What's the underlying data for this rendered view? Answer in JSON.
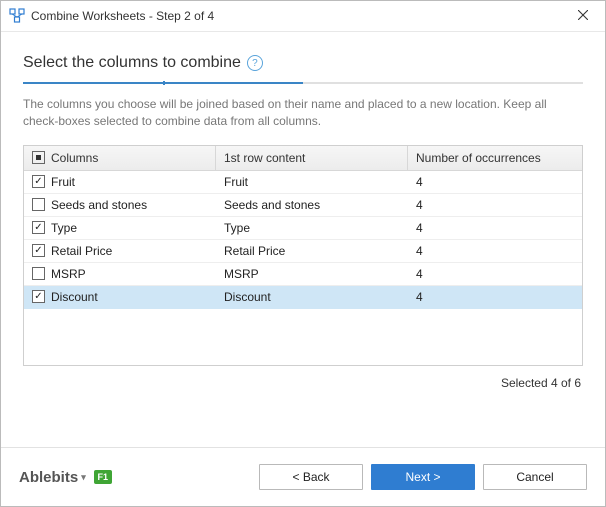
{
  "window": {
    "title": "Combine Worksheets - Step 2 of 4"
  },
  "header": {
    "heading": "Select the columns to combine",
    "help_tooltip": "?"
  },
  "description": "The columns you choose will be joined based on their name and placed to a new location. Keep all check-boxes selected to combine data from all columns.",
  "table": {
    "headers": {
      "columns": "Columns",
      "first_row": "1st row content",
      "occurrences": "Number of occurrences"
    },
    "rows": [
      {
        "checked": true,
        "selected": false,
        "name": "Fruit",
        "first_row": "Fruit",
        "occurrences": "4"
      },
      {
        "checked": false,
        "selected": false,
        "name": "Seeds and stones",
        "first_row": "Seeds and stones",
        "occurrences": "4"
      },
      {
        "checked": true,
        "selected": false,
        "name": "Type",
        "first_row": "Type",
        "occurrences": "4"
      },
      {
        "checked": true,
        "selected": false,
        "name": "Retail Price",
        "first_row": "Retail Price",
        "occurrences": "4"
      },
      {
        "checked": false,
        "selected": false,
        "name": "MSRP",
        "first_row": "MSRP",
        "occurrences": "4"
      },
      {
        "checked": true,
        "selected": true,
        "name": "Discount",
        "first_row": "Discount",
        "occurrences": "4"
      }
    ]
  },
  "summary": "Selected 4 of 6",
  "footer": {
    "brand": "Ablebits",
    "f1": "F1",
    "back": "<  Back",
    "next": "Next  >",
    "cancel": "Cancel"
  }
}
